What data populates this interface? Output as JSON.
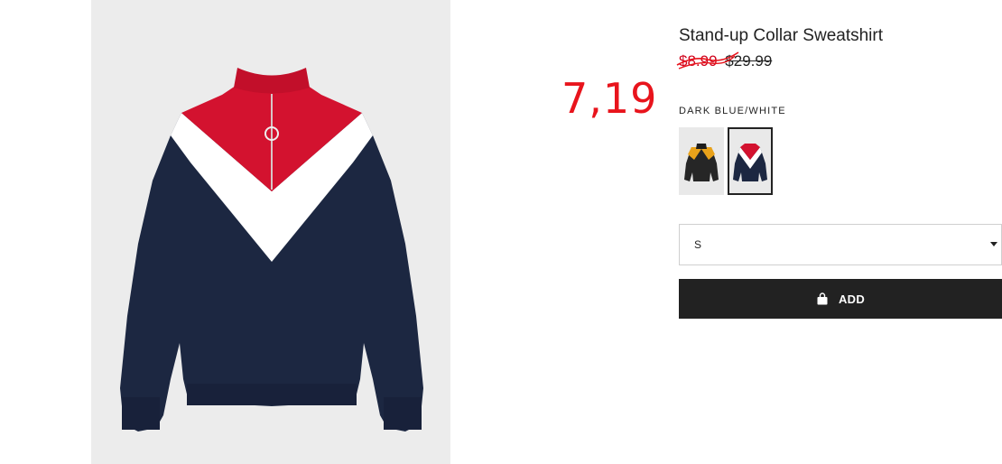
{
  "product": {
    "title": "Stand-up Collar Sweatshirt",
    "sale_price": "$8.99",
    "original_price": "$29.99",
    "annotation": "7,19"
  },
  "colors": {
    "label": "DARK BLUE/WHITE",
    "swatches": [
      {
        "name": "black-yellow",
        "selected": false
      },
      {
        "name": "dark-blue-white",
        "selected": true
      }
    ]
  },
  "size": {
    "selected": "S"
  },
  "cart": {
    "add_label": "ADD",
    "icon": "shopping-bag-icon"
  },
  "theme": {
    "sale_red": "#d0021b",
    "navy": "#1c2741",
    "collar_red": "#d3122f",
    "button_black": "#222222"
  }
}
